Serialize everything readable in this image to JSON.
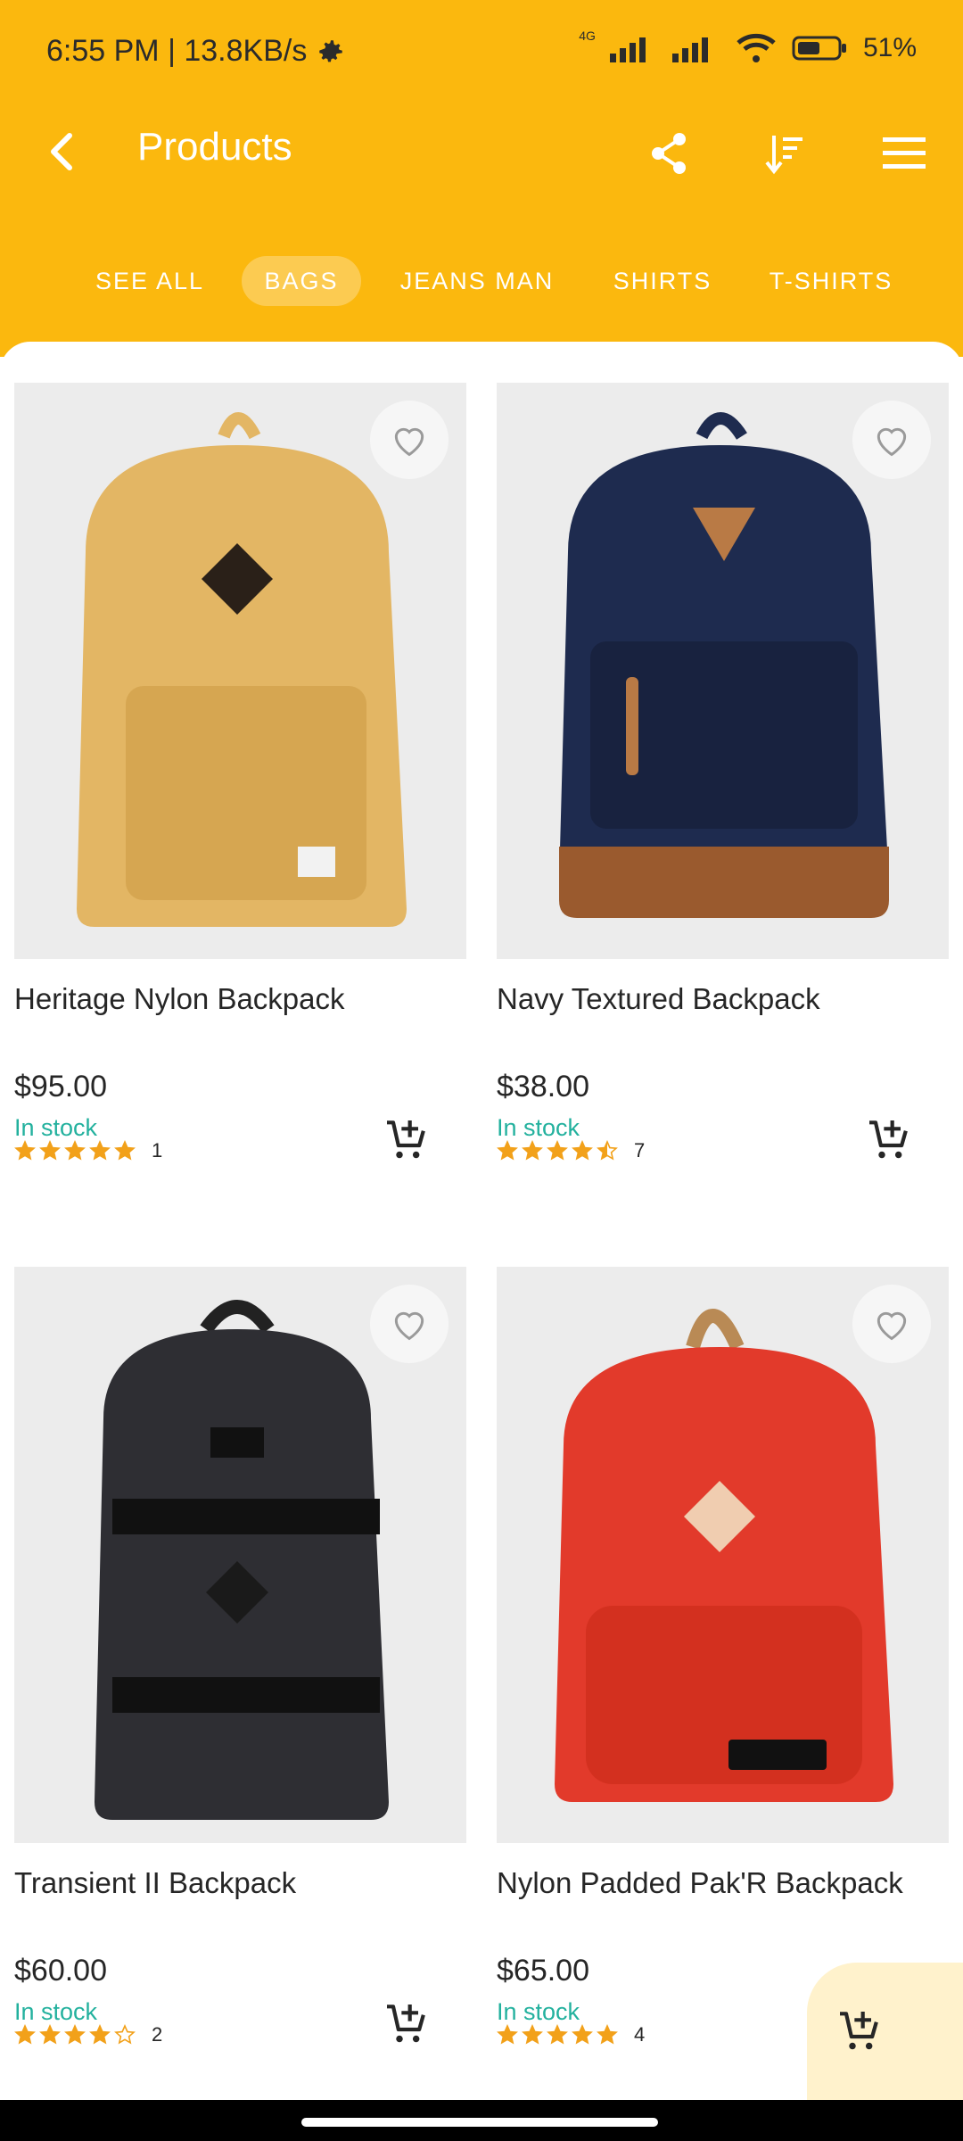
{
  "status": {
    "time_speed": "6:55 PM | 13.8KB/s",
    "network": "4G",
    "battery": "51%"
  },
  "appbar": {
    "title": "Products"
  },
  "tabs": [
    {
      "label": "SEE ALL",
      "active": false
    },
    {
      "label": "BAGS",
      "active": true
    },
    {
      "label": "JEANS MAN",
      "active": false
    },
    {
      "label": "SHIRTS",
      "active": false
    },
    {
      "label": "T-SHIRTS",
      "active": false
    }
  ],
  "products": [
    {
      "name": "Heritage Nylon Backpack",
      "price": "$95.00",
      "stock": "In stock",
      "rating": 5,
      "count": "1",
      "color": "#E3B664"
    },
    {
      "name": "Navy Textured Backpack",
      "price": "$38.00",
      "stock": "In stock",
      "rating": 4.5,
      "count": "7",
      "color": "#1E2B4F"
    },
    {
      "name": "Transient II Backpack",
      "price": "$60.00",
      "stock": "In stock",
      "rating": 4,
      "count": "2",
      "color": "#2E2E33"
    },
    {
      "name": "Nylon Padded Pak'R Backpack",
      "price": "$65.00",
      "stock": "In stock",
      "rating": 5,
      "count": "4",
      "color": "#E23A2B"
    }
  ],
  "colors": {
    "brand": "#FBB80E",
    "stock": "#23B19E",
    "star": "#F2A11A"
  },
  "icons": [
    "back-arrow-icon",
    "share-icon",
    "sort-icon",
    "menu-icon",
    "heart-icon",
    "add-cart-icon",
    "star-icon"
  ]
}
